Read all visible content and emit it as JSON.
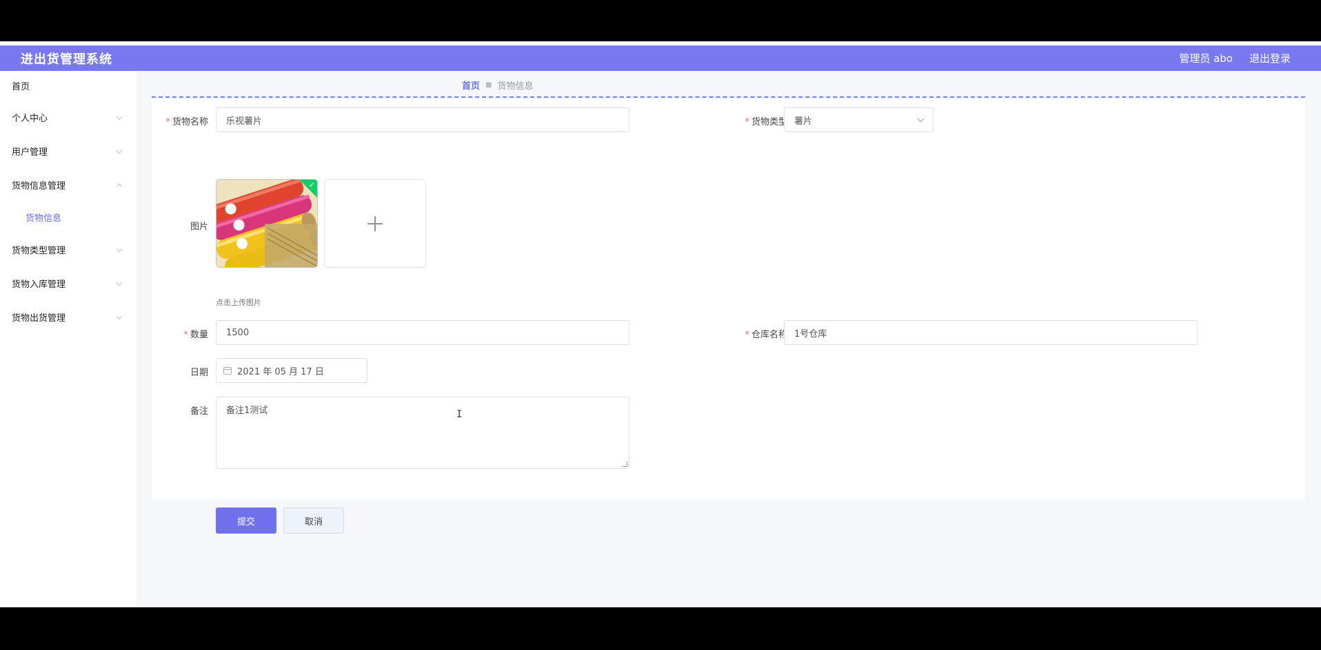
{
  "header": {
    "title": "进出货管理系统",
    "user": "管理员 abo",
    "logout": "退出登录",
    "color": "#7878f0"
  },
  "sidebar": {
    "items": [
      {
        "label": "首页"
      },
      {
        "label": "个人中心"
      },
      {
        "label": "用户管理"
      },
      {
        "label": "货物信息管理"
      },
      {
        "label": "货物信息"
      },
      {
        "label": "货物类型管理"
      },
      {
        "label": "货物入库管理"
      },
      {
        "label": "货物出货管理"
      }
    ]
  },
  "breadcrumb": {
    "home": "首页",
    "separator": "■",
    "current": "货物信息"
  },
  "form": {
    "name_label": "货物名称",
    "name_value": "乐视薯片",
    "type_label": "货物类型",
    "type_value": "薯片",
    "image_label": "图片",
    "upload_tip": "点击上传图片",
    "qty_label": "数量",
    "qty_value": "1500",
    "warehouse_label": "仓库名称",
    "warehouse_value": "1号仓库",
    "date_label": "日期",
    "date_value": "2021 年 05 月 17 日",
    "remark_label": "备注",
    "remark_value": "备注1测试",
    "required_mark": "*",
    "check_mark": "✓",
    "submit": "提交",
    "cancel": "取消",
    "cursor": "I"
  }
}
